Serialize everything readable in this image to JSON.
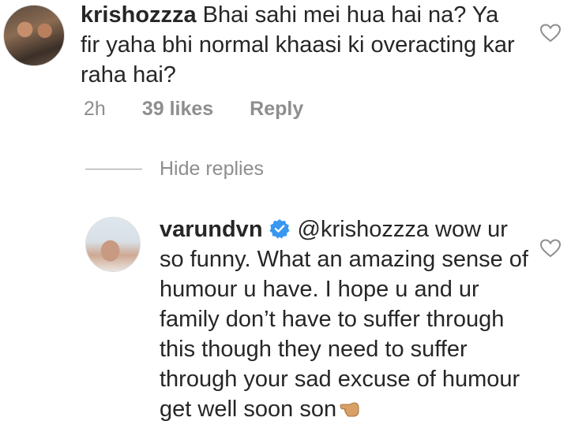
{
  "comment1": {
    "username": "krishozzza",
    "text": "Bhai sahi mei hua hai na? Ya fir yaha bhi normal khaasi ki overacting kar raha hai?",
    "time": "2h",
    "likes": "39 likes",
    "reply_label": "Reply"
  },
  "hide_replies_label": "Hide replies",
  "comment2": {
    "username": "varundvn",
    "verified": true,
    "mention": "@krishozzza",
    "text": "wow ur so funny. What an amazing sense of humour u have. I hope u and ur family don’t have to suffer through this though they need to suffer through your sad excuse of humour get well soon son",
    "emoji": "backhand-index-pointing-left"
  },
  "colors": {
    "text": "#262626",
    "secondary": "#8e8e8e",
    "verified_blue": "#3897f0"
  }
}
